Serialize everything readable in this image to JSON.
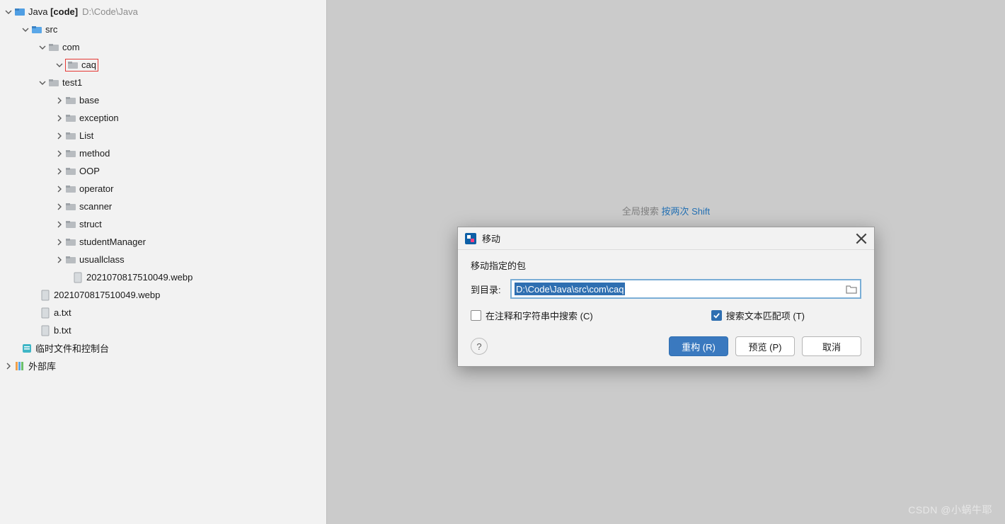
{
  "tree": {
    "root": {
      "name": "Java",
      "tag": "[code]",
      "path": "D:\\Code\\Java"
    },
    "src": "src",
    "com": "com",
    "caq": "caq",
    "test1": "test1",
    "test1_children": [
      "base",
      "exception",
      "List",
      "method",
      "OOP",
      "operator",
      "scanner",
      "struct",
      "studentManager",
      "usuallclass"
    ],
    "webp_inner": "2021070817510049.webp",
    "webp_outer": "2021070817510049.webp",
    "a_txt": "a.txt",
    "b_txt": "b.txt",
    "scratch": "临时文件和控制台",
    "lib": "外部库"
  },
  "hint": {
    "prefix": "全局搜索 ",
    "link": "按两次 Shift"
  },
  "dialog": {
    "title": "移动",
    "subtitle": "移动指定的包",
    "field_label": "到目录:",
    "field_value": "D:\\Code\\Java\\src\\com\\caq",
    "chk1": "在注释和字符串中搜索 (C)",
    "chk2": "搜索文本匹配项 (T)",
    "btn_primary": "重构 (R)",
    "btn_preview": "预览 (P)",
    "btn_cancel": "取消"
  },
  "watermark": "CSDN @小蜗牛耶"
}
